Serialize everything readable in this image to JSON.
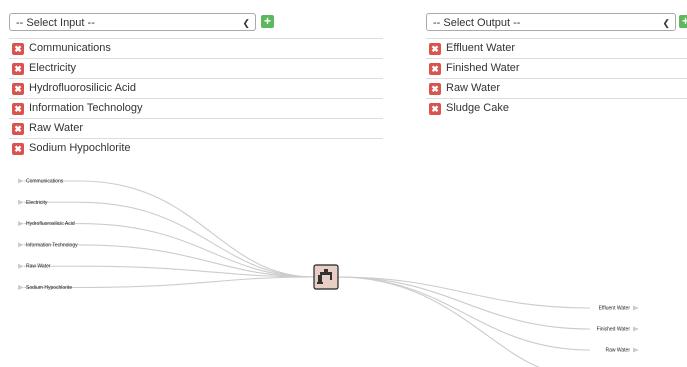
{
  "inputs": {
    "select_placeholder": "-- Select Input --",
    "items": [
      {
        "label": "Communications"
      },
      {
        "label": "Electricity"
      },
      {
        "label": "Hydrofluorosilicic Acid"
      },
      {
        "label": "Information Technology"
      },
      {
        "label": "Raw Water"
      },
      {
        "label": "Sodium Hypochlorite"
      }
    ]
  },
  "outputs": {
    "select_placeholder": "-- Select Output --",
    "items": [
      {
        "label": "Effluent Water"
      },
      {
        "label": "Finished Water"
      },
      {
        "label": "Raw Water"
      },
      {
        "label": "Sludge Cake"
      }
    ]
  },
  "graph": {
    "input_labels": [
      "Communications",
      "Electricity",
      "Hydrofluorosilicic Acid",
      "Information Technology",
      "Raw Water",
      "Sodium Hypochlorite"
    ],
    "output_labels": [
      "Effluent Water",
      "Finished Water",
      "Raw Water"
    ],
    "center_icon": "faucet-icon"
  },
  "colors": {
    "add": "#5cb85c",
    "remove": "#d9534f",
    "node_fill": "#e8cfc5",
    "link": "#cccccc"
  }
}
